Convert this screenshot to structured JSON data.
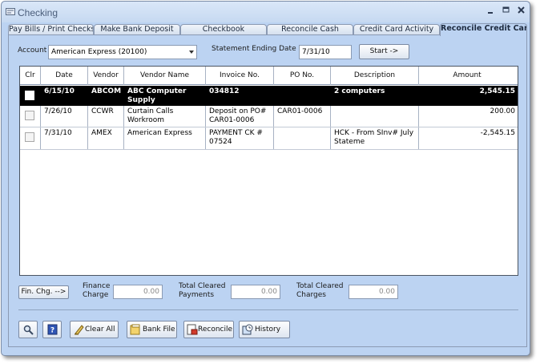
{
  "window": {
    "title": "Checking",
    "app_icon": "checkbook-app-icon"
  },
  "window_controls": [
    {
      "name": "minimize-button",
      "glyph": "_"
    },
    {
      "name": "maximize-button",
      "glyph": "□"
    },
    {
      "name": "close-button",
      "glyph": "✕"
    }
  ],
  "tabs": [
    {
      "label": "Pay Bills / Print Checks",
      "active": false
    },
    {
      "label": "Make Bank Deposit",
      "active": false
    },
    {
      "label": "Checkbook",
      "active": false
    },
    {
      "label": "Reconcile Cash",
      "active": false
    },
    {
      "label": "Credit Card Activity",
      "active": false
    },
    {
      "label": "Reconcile Credit Card",
      "active": true
    }
  ],
  "account": {
    "label": "Account",
    "value": "American Express (20100)"
  },
  "statement": {
    "label": "Statement Ending Date",
    "value": "7/31/10"
  },
  "start_button": {
    "label": "Start ->"
  },
  "grid": {
    "columns": [
      "Clr",
      "Date",
      "Vendor",
      "Vendor Name",
      "Invoice No.",
      "PO No.",
      "Description",
      "Amount"
    ],
    "rows": [
      {
        "date": "6/15/10",
        "vendor": "ABCOM",
        "vendor_name": "ABC Computer Supply",
        "invoice_line1": "034812",
        "invoice_line2": "",
        "po": "",
        "desc_line1": "2 computers",
        "desc_line2": "",
        "amount": "2,545.15",
        "selected": true,
        "cleared": false
      },
      {
        "date": "7/26/10",
        "vendor": "CCWR",
        "vendor_name": "Curtain Calls Workroom",
        "invoice_line1": "Deposit on PO#",
        "invoice_line2": "CAR01-0006",
        "po": "CAR01-0006",
        "desc_line1": "",
        "desc_line2": "",
        "amount": "200.00",
        "selected": false,
        "cleared": false
      },
      {
        "date": "7/31/10",
        "vendor": "AMEX",
        "vendor_name": "American Express",
        "invoice_line1": "PAYMENT CK #",
        "invoice_line2": "07524",
        "po": "",
        "desc_line1": "HCK - From SInv# July",
        "desc_line2": "Stateme",
        "amount": "-2,545.15",
        "selected": false,
        "cleared": false
      }
    ]
  },
  "fin_chg_button": {
    "label": "Fin. Chg. -->"
  },
  "totals": {
    "finance_charge": {
      "label_line1": "Finance",
      "label_line2": "Charge",
      "value": "0.00"
    },
    "cleared_payments": {
      "label_line1": "Total Cleared",
      "label_line2": "Payments",
      "value": "0.00"
    },
    "cleared_charges": {
      "label_line1": "Total Cleared",
      "label_line2": "Charges",
      "value": "0.00"
    }
  },
  "toolbar": {
    "search_icon": "magnifier-icon",
    "help_icon": "help-book-icon",
    "clear_all": "Clear All",
    "bank_file": "Bank File",
    "reconcile": "Reconcile",
    "history": "History"
  },
  "colors": {
    "background": "#bcd3f2",
    "selected_row": "#000000",
    "border": "#8b9ab3"
  }
}
